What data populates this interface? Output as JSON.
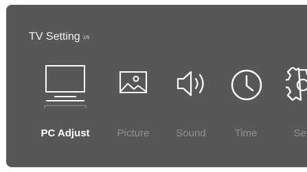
{
  "menu": {
    "title": "TV Setting",
    "page_indicator": "2/5",
    "items": [
      {
        "label": "PC Adjust",
        "icon": "monitor-icon",
        "selected": true
      },
      {
        "label": "Picture",
        "icon": "picture-icon",
        "selected": false
      },
      {
        "label": "Sound",
        "icon": "speaker-icon",
        "selected": false
      },
      {
        "label": "Time",
        "icon": "clock-icon",
        "selected": false
      },
      {
        "label": "Set",
        "icon": "gear-icon",
        "selected": false
      }
    ]
  },
  "colors": {
    "panel_bg": "#575757",
    "active_text": "#ffffff",
    "inactive_text": "#8f8f8f",
    "icon_stroke": "#ffffff"
  }
}
